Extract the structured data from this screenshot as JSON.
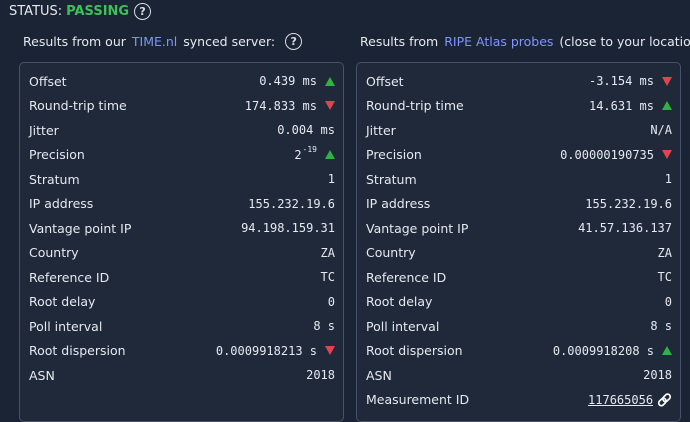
{
  "status": {
    "label": "STATUS:",
    "value": "PASSING"
  },
  "left": {
    "title_prefix": "Results from our",
    "title_link": "TIME.nl",
    "title_suffix": "synced server:",
    "rows": [
      {
        "label": "Offset",
        "value": "0.439 ms",
        "trend": "up"
      },
      {
        "label": "Round-trip time",
        "value": "174.833 ms",
        "trend": "down"
      },
      {
        "label": "Jitter",
        "value": "0.004 ms"
      },
      {
        "label": "Precision",
        "value": "2",
        "exp": "-19",
        "trend": "up"
      },
      {
        "label": "Stratum",
        "value": "1"
      },
      {
        "label": "IP address",
        "value": "155.232.19.6"
      },
      {
        "label": "Vantage point IP",
        "value": "94.198.159.31"
      },
      {
        "label": "Country",
        "value": "ZA"
      },
      {
        "label": "Reference ID",
        "value": "TC"
      },
      {
        "label": "Root delay",
        "value": "0"
      },
      {
        "label": "Poll interval",
        "value": "8 s"
      },
      {
        "label": "Root dispersion",
        "value": "0.0009918213 s",
        "trend": "down"
      },
      {
        "label": "ASN",
        "value": "2018"
      }
    ]
  },
  "right": {
    "title_prefix": "Results from",
    "title_link": "RIPE Atlas probes",
    "title_suffix": "(close to your location):",
    "rows": [
      {
        "label": "Offset",
        "value": "-3.154 ms",
        "trend": "down"
      },
      {
        "label": "Round-trip time",
        "value": "14.631 ms",
        "trend": "up"
      },
      {
        "label": "Jitter",
        "value": "N/A"
      },
      {
        "label": "Precision",
        "value": "0.00000190735",
        "trend": "down"
      },
      {
        "label": "Stratum",
        "value": "1"
      },
      {
        "label": "IP address",
        "value": "155.232.19.6"
      },
      {
        "label": "Vantage point IP",
        "value": "41.57.136.137"
      },
      {
        "label": "Country",
        "value": "ZA"
      },
      {
        "label": "Reference ID",
        "value": "TC"
      },
      {
        "label": "Root delay",
        "value": "0"
      },
      {
        "label": "Poll interval",
        "value": "8 s"
      },
      {
        "label": "Root dispersion",
        "value": "0.0009918208 s",
        "trend": "up"
      },
      {
        "label": "ASN",
        "value": "2018"
      },
      {
        "label": "Measurement ID",
        "value": "117665056",
        "link": true
      }
    ]
  },
  "colors": {
    "up": "#2fb344",
    "down": "#e0454f",
    "link": "#7f94ff",
    "passing": "#3fbf5a"
  }
}
